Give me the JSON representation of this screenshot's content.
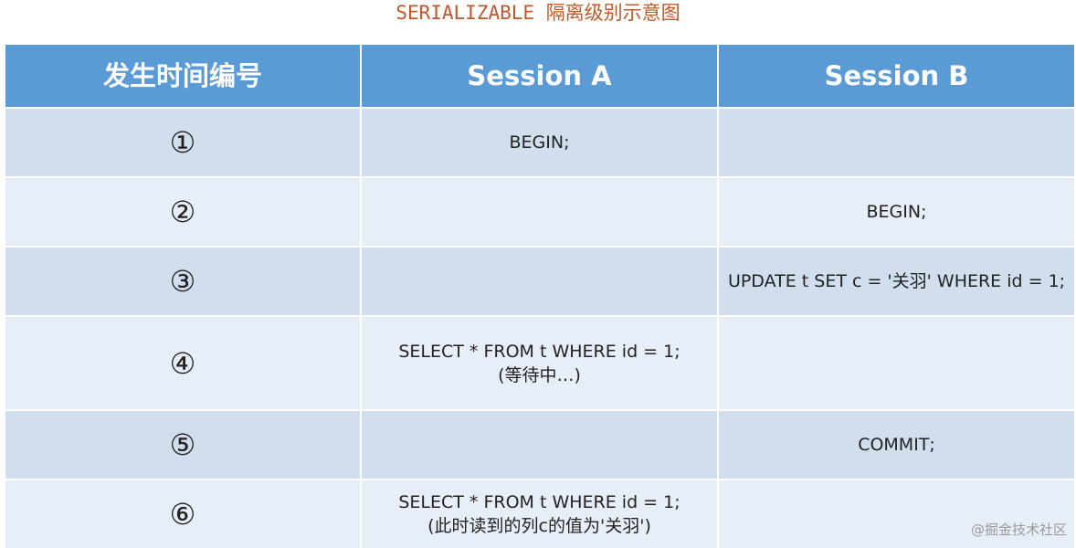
{
  "title": "SERIALIZABLE 隔离级别示意图",
  "headers": [
    "发生时间编号",
    "Session A",
    "Session B"
  ],
  "rows": [
    {
      "num": "①",
      "a": [
        "BEGIN;"
      ],
      "b": [
        ""
      ]
    },
    {
      "num": "②",
      "a": [
        ""
      ],
      "b": [
        "BEGIN;"
      ]
    },
    {
      "num": "③",
      "a": [
        ""
      ],
      "b": [
        "UPDATE t SET c = '关羽' WHERE id = 1;"
      ]
    },
    {
      "num": "④",
      "a": [
        "SELECT * FROM t WHERE id = 1;",
        "(等待中…)"
      ],
      "b": [
        ""
      ]
    },
    {
      "num": "⑤",
      "a": [
        ""
      ],
      "b": [
        "COMMIT;"
      ]
    },
    {
      "num": "⑥",
      "a": [
        "SELECT * FROM t WHERE id = 1;",
        "(此时读到的列c的值为'关羽')"
      ],
      "b": [
        ""
      ]
    }
  ],
  "watermark": "@掘金技术社区",
  "colors": {
    "header_bg": "#5b9bd5",
    "row_odd_bg": "#d1deee",
    "row_even_bg": "#e8eef7",
    "title": "#c0582a"
  }
}
